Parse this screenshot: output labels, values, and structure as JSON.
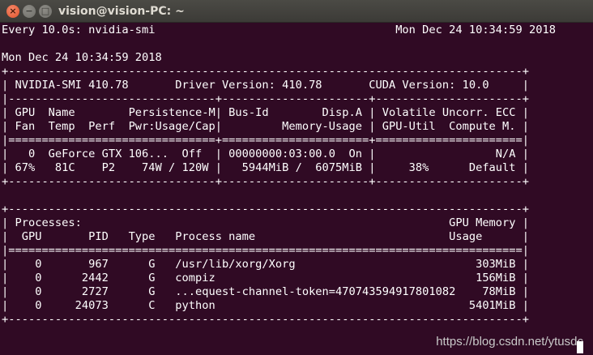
{
  "window": {
    "title": "vision@vision-PC: ~",
    "close_glyph": "×",
    "minimize_glyph": "−",
    "maximize_glyph": "□"
  },
  "terminal": {
    "lines": [
      "Every 10.0s: nvidia-smi                                    Mon Dec 24 10:34:59 2018",
      "",
      "Mon Dec 24 10:34:59 2018",
      "+-----------------------------------------------------------------------------+",
      "| NVIDIA-SMI 410.78       Driver Version: 410.78       CUDA Version: 10.0     |",
      "|-------------------------------+----------------------+----------------------+",
      "| GPU  Name        Persistence-M| Bus-Id        Disp.A | Volatile Uncorr. ECC |",
      "| Fan  Temp  Perf  Pwr:Usage/Cap|         Memory-Usage | GPU-Util  Compute M. |",
      "|===============================+======================+======================|",
      "|   0  GeForce GTX 106...  Off  | 00000000:03:00.0  On |                  N/A |",
      "| 67%   81C    P2    74W / 120W |   5944MiB /  6075MiB |     38%      Default |",
      "+-------------------------------+----------------------+----------------------+",
      "",
      "+-----------------------------------------------------------------------------+",
      "| Processes:                                                       GPU Memory |",
      "|  GPU       PID   Type   Process name                             Usage      |",
      "|=============================================================================|",
      "|    0       967      G   /usr/lib/xorg/Xorg                           303MiB |",
      "|    0      2442      G   compiz                                       156MiB |",
      "|    0      2727      G   ...equest-channel-token=470743594917801082    78MiB |",
      "|    0     24073      C   python                                      5401MiB |",
      "+-----------------------------------------------------------------------------+"
    ]
  },
  "watermark": "https://blog.csdn.net/ytusdc"
}
